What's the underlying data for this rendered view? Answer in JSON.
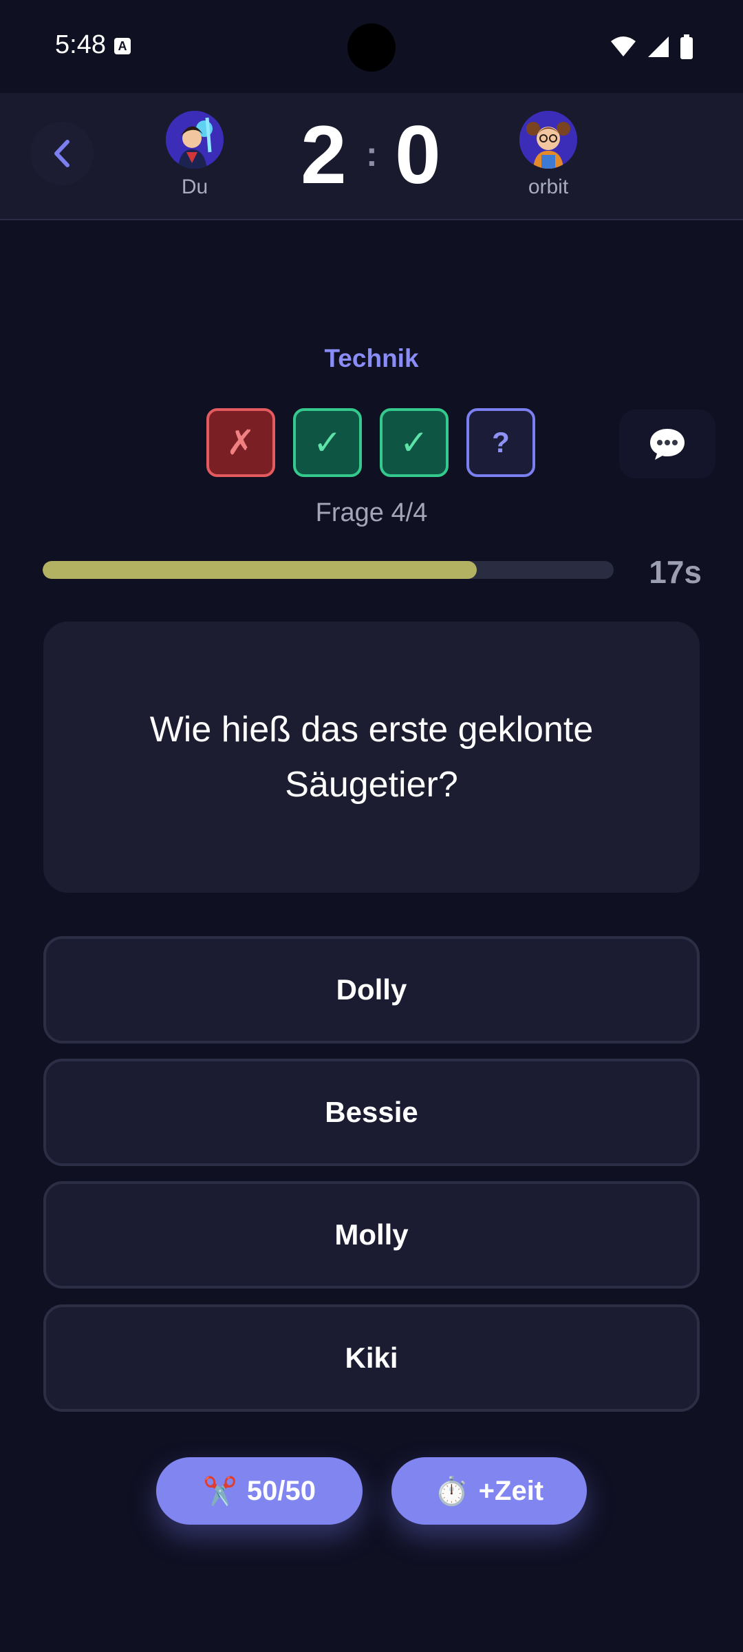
{
  "status_bar": {
    "time": "5:48",
    "indicator": "A"
  },
  "header": {
    "player_left": {
      "name": "Du",
      "score": "2"
    },
    "player_right": {
      "name": "orbit",
      "score": "0"
    },
    "separator": ":"
  },
  "quiz": {
    "category": "Technik",
    "progress_boxes": [
      {
        "state": "wrong",
        "symbol": "✗"
      },
      {
        "state": "correct",
        "symbol": "✓"
      },
      {
        "state": "correct",
        "symbol": "✓"
      },
      {
        "state": "current",
        "symbol": "?"
      }
    ],
    "question_counter": "Frage 4/4",
    "time_remaining_label": "17s",
    "time_remaining_fraction": 0.76,
    "question": "Wie hieß das erste geklonte Säugetier?",
    "answers": [
      "Dolly",
      "Bessie",
      "Molly",
      "Kiki"
    ]
  },
  "jokers": {
    "fifty_fifty": {
      "icon": "✂️",
      "label": "50/50"
    },
    "extra_time": {
      "icon": "⏱️",
      "label": "+Zeit"
    }
  },
  "colors": {
    "background": "#0f1022",
    "accent": "#8185f0",
    "correct": "#34c98d",
    "wrong": "#e35b5e",
    "timer_fill": "#b3b262"
  }
}
